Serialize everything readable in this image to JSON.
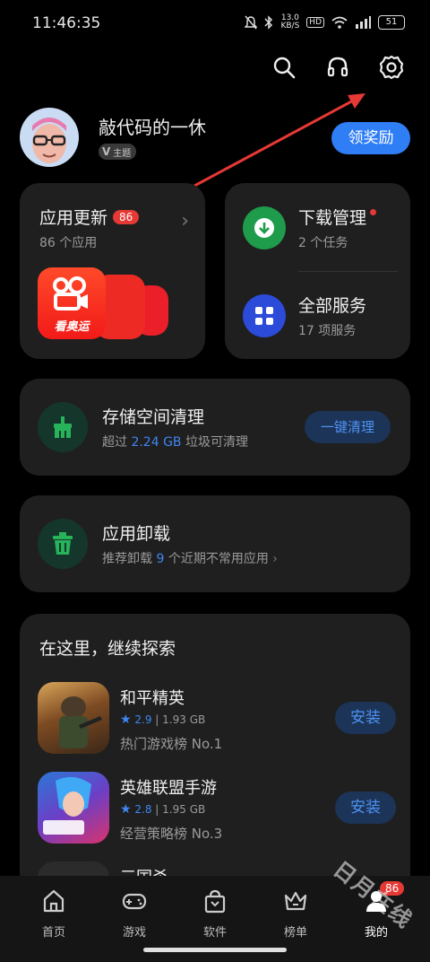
{
  "status": {
    "time": "11:46:35",
    "net_speed_top": "13.0",
    "net_speed_unit": "KB/S",
    "hd": "HD",
    "signal": "5G",
    "battery": "51"
  },
  "profile": {
    "name": "敲代码的一休",
    "tag": "主题",
    "claim_label": "领奖励"
  },
  "update": {
    "title": "应用更新",
    "badge": "86",
    "sub": "86 个应用",
    "app_label": "看奥运"
  },
  "download": {
    "title": "下载管理",
    "sub": "2 个任务"
  },
  "services": {
    "title": "全部服务",
    "sub": "17 项服务"
  },
  "storage": {
    "title": "存储空间清理",
    "sub_pre": "超过 ",
    "sub_value": "2.24 GB",
    "sub_post": " 垃圾可清理",
    "button": "一键清理"
  },
  "uninstall": {
    "title": "应用卸载",
    "sub_pre": "推荐卸载 ",
    "sub_value": "9",
    "sub_post": " 个近期不常用应用"
  },
  "explore": {
    "title": "在这里，继续探索",
    "games": [
      {
        "name": "和平精英",
        "rating": "2.9",
        "size": "1.93 GB",
        "rank": "热门游戏榜 No.1",
        "button": "安装"
      },
      {
        "name": "英雄联盟手游",
        "rating": "2.8",
        "size": "1.95 GB",
        "rank": "经营策略榜 No.3",
        "button": "安装"
      },
      {
        "name": "三国杀"
      }
    ]
  },
  "nav": {
    "tabs": [
      {
        "label": "首页"
      },
      {
        "label": "游戏"
      },
      {
        "label": "软件"
      },
      {
        "label": "榜单"
      },
      {
        "label": "我的",
        "badge": "86"
      }
    ]
  },
  "watermark": "日月在线",
  "colors": {
    "accent": "#2f7ef5",
    "badge": "#e53935",
    "green": "#1f9b4c"
  }
}
